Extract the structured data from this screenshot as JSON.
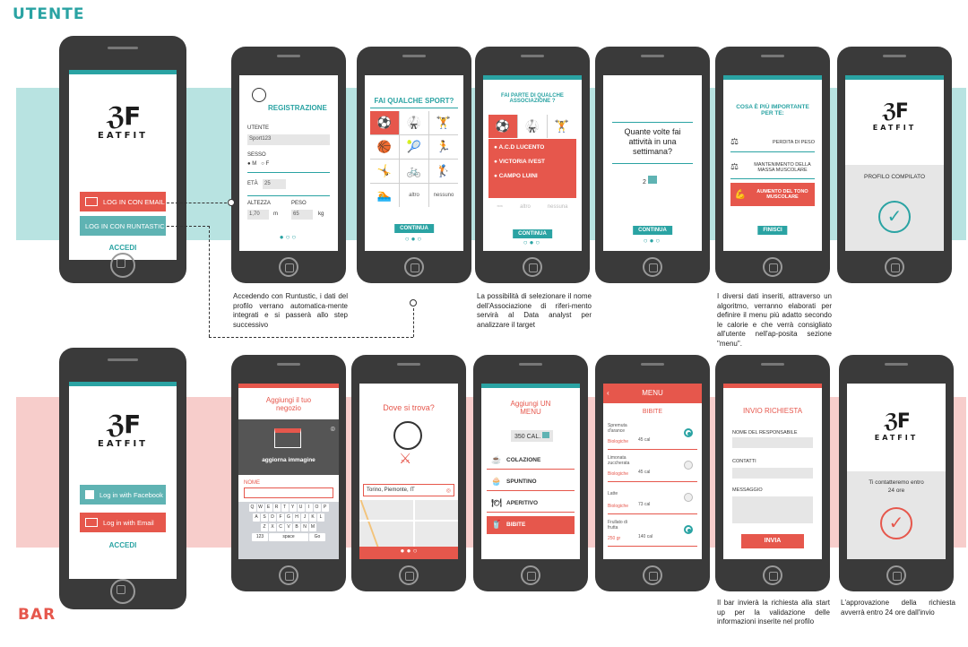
{
  "sections": {
    "top": "UTENTE",
    "bottom": "BAR"
  },
  "colors": {
    "teal": "#2aa3a3",
    "red": "#e6574c",
    "band_teal": "#b8e3e1",
    "band_red": "#f7cdcb"
  },
  "logo": {
    "text": "EATFIT"
  },
  "user_login": {
    "email_btn": "LOG IN CON EMAIL",
    "runtastic_btn": "LOG IN CON RUNTASTIC",
    "access": "ACCEDI"
  },
  "registration": {
    "title": "REGISTRAZIONE",
    "user_label": "UTENTE",
    "user_value": "Sport123",
    "sex_label": "SESSO",
    "sex_m": "M",
    "sex_f": "F",
    "age_label": "ETÀ",
    "age_value": "25",
    "height_label": "ALTEZZA",
    "height_value": "1,70",
    "height_unit": "m",
    "weight_label": "PESO",
    "weight_value": "65",
    "weight_unit": "kg"
  },
  "sport": {
    "title": "FAI QUALCHE SPORT?",
    "opt_altro": "altro",
    "opt_nessuno": "nessuno",
    "continue": "CONTINUA"
  },
  "association": {
    "title": "FAI PARTE DI QUALCHE ASSOCIAZIONE ?",
    "items": [
      "A.C.D LUCENTO",
      "VICTORIA IVEST",
      "CAMPO LUINI"
    ],
    "opt_altro": "altro",
    "opt_nessuno": "nessuna",
    "continue": "CONTINUA"
  },
  "frequency": {
    "question": "Quante volte fai attività in una settimana?",
    "value": "2",
    "continue": "CONTINUA"
  },
  "goals": {
    "title": "COSA È PIÙ IMPORTANTE PER TE:",
    "items": [
      "PERDITA DI PESO",
      "MANTENIMENTO DELLA MASSA MUSCOLARE",
      "AUMENTO DEL TONO MUSCOLARE"
    ],
    "finish": "FINISCI"
  },
  "profile_done": {
    "text": "PROFILO COMPILATO"
  },
  "notes": {
    "runtastic": "Accedendo con Runtustic, i dati del profilo verrano automatica-mente integrati e si passerà allo step successivo",
    "association": "La possibilità di selezionare il nome dell'Associazione di riferi-mento servirà al Data analyst per analizzare il target",
    "algorithm": "I diversi dati inseriti, attraverso un algoritmo, verranno elaborati per definire il menu più adatto secondo le calorie e che verrà consigliato all'utente nell'ap-posita sezione \"menu\".",
    "validation": "Il bar invierà la richiesta alla start up per la validazione delle informazioni inserite nel profilo",
    "approval": "L'approvazione della richiesta avverrà entro 24 ore dall'invio"
  },
  "bar_login": {
    "facebook_btn": "Log in with Facebook",
    "email_btn": "Log in with Email",
    "access": "ACCEDI"
  },
  "add_shop": {
    "title": "Aggiungi il tuo negozio",
    "update_image": "aggiorna immagine",
    "name_label": "NOME",
    "kb_row1": "QWERTYUIOP",
    "kb_row2": "ASDFGHJKL",
    "kb_row3": "ZXCVBNM",
    "space": "space",
    "go": "Go"
  },
  "location": {
    "title": "Dove si trova?",
    "address": "Torino, Piemonte, IT"
  },
  "add_menu": {
    "title": "Aggiungi UN MENU",
    "cal": "350 CAL.",
    "items": [
      "COLAZIONE",
      "SPUNTINO",
      "APERITIVO",
      "BIBITE"
    ]
  },
  "menu": {
    "title": "MENU",
    "subtitle": "BIBITE",
    "drinks": [
      {
        "name": "Spremuta d'arance",
        "tag": "Biologiche",
        "cal": "45 cal",
        "checked": true
      },
      {
        "name": "Limonata zuccherata",
        "tag": "Biologiche",
        "cal": "45 cal",
        "checked": false
      },
      {
        "name": "Latte",
        "tag": "Biologiche",
        "cal": "73 cal",
        "checked": false
      },
      {
        "name": "Frullato di frutta",
        "tag": "250 gr",
        "cal": "140 cal",
        "checked": true
      }
    ]
  },
  "request": {
    "title": "INVIO RICHIESTA",
    "manager_label": "NOME DEL RESPONSABILE",
    "contacts_label": "CONTATTI",
    "message_label": "MESSAGGIO",
    "send": "INVIA"
  },
  "bar_done": {
    "text": "Ti contatteremo entro 24 ore"
  }
}
